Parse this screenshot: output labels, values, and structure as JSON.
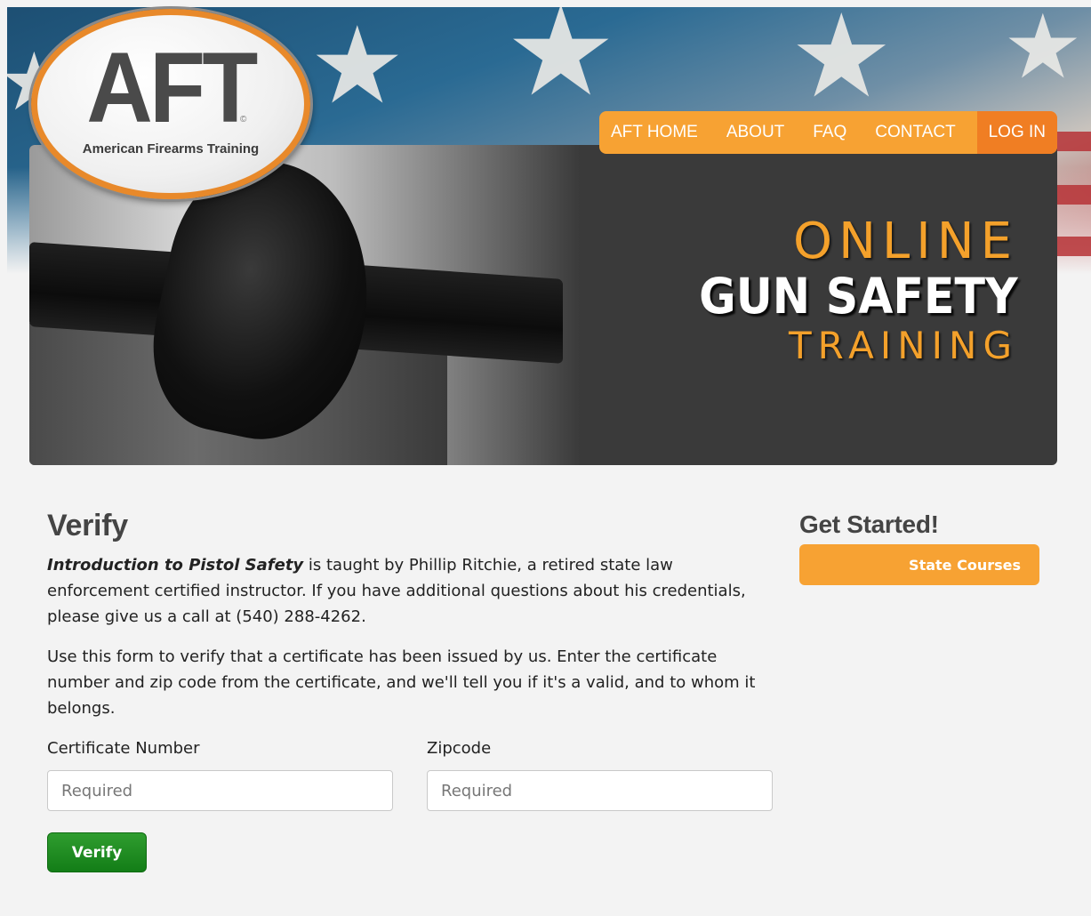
{
  "logo": {
    "letters": "AFT",
    "subtitle": "American Firearms Training",
    "mark": "©"
  },
  "nav": {
    "items": [
      {
        "label": "AFT HOME"
      },
      {
        "label": "ABOUT"
      },
      {
        "label": "FAQ"
      },
      {
        "label": "CONTACT"
      },
      {
        "label": "LOG IN"
      }
    ]
  },
  "hero": {
    "line1": "ONLINE",
    "line2": "GUN SAFETY",
    "line3": "TRAINING"
  },
  "main": {
    "title": "Verify",
    "intro_course": "Introduction to Pistol Safety",
    "intro_rest": " is taught by Phillip Ritchie, a retired state law enforcement certified instructor.  If you have additional questions about his credentials, please give us a call at (540) 288-4262.",
    "instructions": "Use this form to verify that a certificate has been issued by us. Enter the certificate number and zip code from the certificate, and we'll tell you if it's a valid, and to whom it belongs.",
    "form": {
      "cert_label": "Certificate Number",
      "cert_placeholder": "Required",
      "cert_value": "",
      "zip_label": "Zipcode",
      "zip_placeholder": "Required",
      "zip_value": "",
      "submit_label": "Verify"
    }
  },
  "sidebar": {
    "title": "Get Started!",
    "button_label": "State Courses"
  },
  "colors": {
    "accent_orange": "#f7a233",
    "login_orange": "#f07e23",
    "verify_green": "#1f8c22",
    "page_bg": "#f3f3f3"
  },
  "icons": {
    "logo": "aft-logo-oval",
    "stars": "flag-star-icon"
  }
}
